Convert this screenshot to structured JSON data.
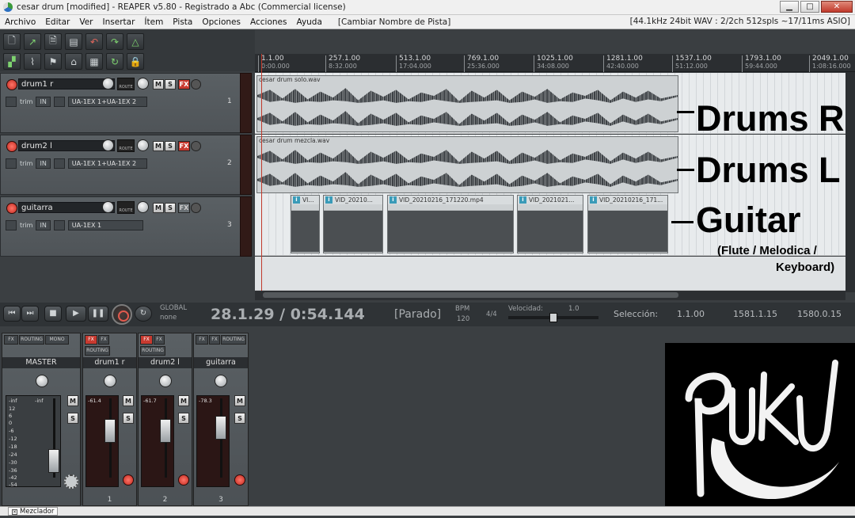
{
  "window": {
    "title": "cesar drum [modified] - REAPER v5.80 - Registrado a Abc (Commercial license)",
    "minimize": "▁",
    "maximize": "□",
    "close": "✕"
  },
  "menu": {
    "items": [
      "Archivo",
      "Editar",
      "Ver",
      "Insertar",
      "Ítem",
      "Pista",
      "Opciones",
      "Acciones",
      "Ayuda"
    ],
    "action": "[Cambiar Nombre de Pista]",
    "status": "[44.1kHz 24bit WAV : 2/2ch 512spls ~17/11ms ASIO]"
  },
  "tracks": [
    {
      "name": "drum1 r",
      "number": "1",
      "routing": "UA-1EX 1+UA-1EX 2",
      "fx_active": true,
      "item": "cesar drum solo.wav",
      "trim": "trim",
      "in": "IN"
    },
    {
      "name": "drum2 l",
      "number": "2",
      "routing": "UA-1EX 1+UA-1EX 2",
      "fx_active": true,
      "item": "cesar drum mezcla.wav",
      "trim": "trim",
      "in": "IN"
    },
    {
      "name": "guitarra",
      "number": "3",
      "routing": "UA-1EX 1",
      "fx_active": false,
      "trim": "trim",
      "in": "IN"
    }
  ],
  "buttons": {
    "mute": "M",
    "solo": "S",
    "fx": "FX",
    "route": "ROUTE"
  },
  "ruler": {
    "marks": [
      {
        "bar": "1.1.00",
        "time": "0:00.000"
      },
      {
        "bar": "257.1.00",
        "time": "8:32.000"
      },
      {
        "bar": "513.1.00",
        "time": "17:04.000"
      },
      {
        "bar": "769.1.00",
        "time": "25:36.000"
      },
      {
        "bar": "1025.1.00",
        "time": "34:08.000"
      },
      {
        "bar": "1281.1.00",
        "time": "42:40.000"
      },
      {
        "bar": "1537.1.00",
        "time": "51:12.000"
      },
      {
        "bar": "1793.1.00",
        "time": "59:44.000"
      },
      {
        "bar": "2049.1.00",
        "time": "1:08:16.000"
      }
    ]
  },
  "video_items": [
    "VI...",
    "VID_20210...",
    "VID_20210216_171220.mp4",
    "VID_2021021...",
    "VID_20210216_171..."
  ],
  "overlays": {
    "drums_r": "Drums R",
    "drums_l": "Drums L",
    "guitar": "Guitar",
    "guitar_note_line1": "(Flute / Melodica /",
    "guitar_note_line2": "Keyboard)"
  },
  "transport": {
    "global_label": "GLOBAL",
    "global_value": "none",
    "position": "28.1.29 / 0:54.144",
    "status": "[Parado]",
    "bpm_label": "BPM",
    "bpm": "120",
    "time_signature": "4/4",
    "rate_label": "Velocidad:",
    "rate": "1.0",
    "selection_label": "Selección:",
    "selection_start": "1.1.00",
    "selection_end": "1581.1.15",
    "selection_length": "1580.0.15"
  },
  "mixer": {
    "strips": [
      {
        "name": "MASTER",
        "number": "",
        "peak": "-inf",
        "peak2": "-inf",
        "scale": [
          "12",
          "6",
          "0",
          "-6",
          "-12",
          "-18",
          "-24",
          "-30",
          "-36",
          "-42",
          "-54"
        ],
        "mono": "MONO"
      },
      {
        "name": "drum1 r",
        "number": "1",
        "peak": "-61.4"
      },
      {
        "name": "drum2 l",
        "number": "2",
        "peak": "-61.7"
      },
      {
        "name": "guitarra",
        "number": "3",
        "peak": "-78.3"
      }
    ],
    "routing": "ROUTING",
    "fx": "FX"
  },
  "bottom_tab": "Mezclador",
  "logo_text": "PUKU",
  "colors": {
    "record": "#e0665c",
    "fx_on": "#c83a30",
    "accent_green": "#7ed36f",
    "arrange_bg": "#e8ebed"
  }
}
